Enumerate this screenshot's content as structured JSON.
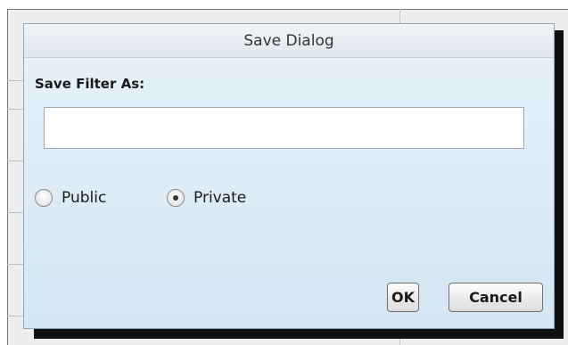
{
  "dialog": {
    "title": "Save Dialog",
    "field_label": "Save Filter As:",
    "filter_name_value": "",
    "visibility": {
      "options": [
        {
          "label": "Public",
          "checked": false
        },
        {
          "label": "Private",
          "checked": true
        }
      ]
    },
    "buttons": {
      "ok_label": "OK",
      "cancel_label": "Cancel"
    }
  },
  "colors": {
    "dialog_background": "#d5e8f5",
    "titlebar_background": "#e6ecf2"
  }
}
